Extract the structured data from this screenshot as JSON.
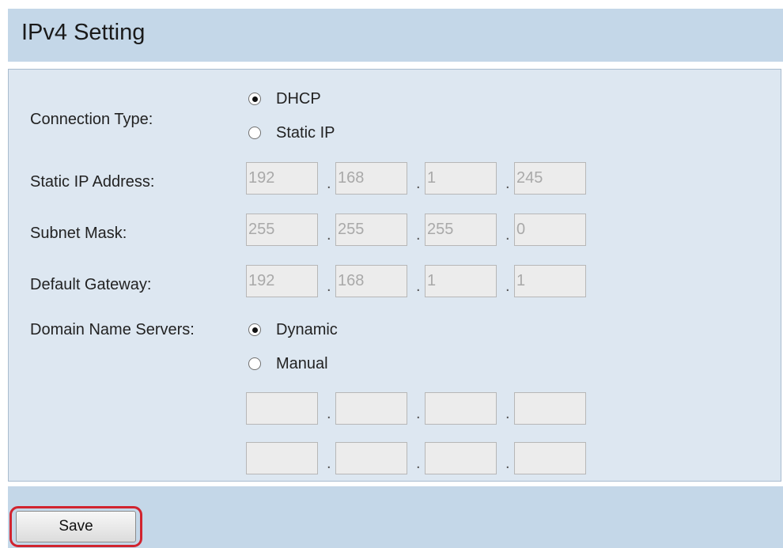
{
  "section": {
    "title": "IPv4 Setting"
  },
  "connection_type": {
    "label": "Connection Type:",
    "options": [
      {
        "label": "DHCP",
        "checked": true
      },
      {
        "label": "Static IP",
        "checked": false
      }
    ]
  },
  "static_ip": {
    "label": "Static IP Address:",
    "octets": [
      "192",
      "168",
      "1",
      "245"
    ]
  },
  "subnet_mask": {
    "label": "Subnet Mask:",
    "octets": [
      "255",
      "255",
      "255",
      "0"
    ]
  },
  "default_gateway": {
    "label": "Default Gateway:",
    "octets": [
      "192",
      "168",
      "1",
      "1"
    ]
  },
  "dns": {
    "label": "Domain Name Servers:",
    "options": [
      {
        "label": "Dynamic",
        "checked": true
      },
      {
        "label": "Manual",
        "checked": false
      }
    ],
    "server1": [
      "",
      "",
      "",
      ""
    ],
    "server2": [
      "",
      "",
      "",
      ""
    ]
  },
  "separator": ".",
  "footer": {
    "save_label": "Save"
  },
  "colors": {
    "header_bg": "#c4d7e8",
    "panel_bg": "#dde7f1",
    "highlight": "#d1242f"
  }
}
